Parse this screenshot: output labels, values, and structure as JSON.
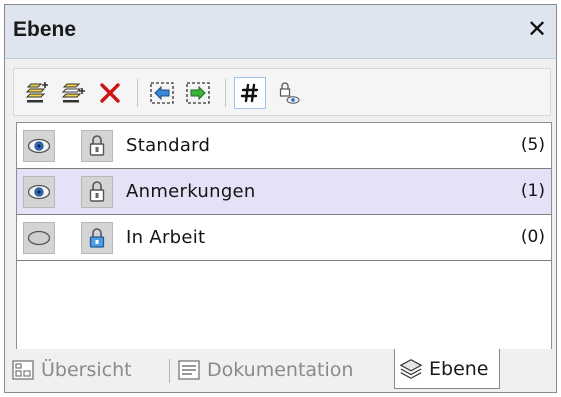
{
  "panel": {
    "title": "Ebene",
    "close_glyph": "✕"
  },
  "toolbar": {
    "buttons": [
      {
        "name": "add-layer-icon",
        "active": false
      },
      {
        "name": "insert-layer-icon",
        "active": false
      },
      {
        "name": "delete-layer-icon",
        "active": false
      },
      {
        "name": "move-to-layer-icon",
        "active": false
      },
      {
        "name": "move-from-layer-icon",
        "active": false
      },
      {
        "name": "show-grid-icon",
        "active": true
      },
      {
        "name": "lock-visibility-icon",
        "active": false
      }
    ]
  },
  "layers": [
    {
      "name": "Standard",
      "count": "(5)",
      "visible": true,
      "locked": false,
      "selected": false
    },
    {
      "name": "Anmerkungen",
      "count": "(1)",
      "visible": true,
      "locked": false,
      "selected": true
    },
    {
      "name": "In Arbeit",
      "count": "(0)",
      "visible": false,
      "locked": true,
      "selected": false
    }
  ],
  "tabs": [
    {
      "label": "Übersicht",
      "icon": "overview-icon",
      "active": false
    },
    {
      "label": "Dokumentation",
      "icon": "documentation-icon",
      "active": false
    },
    {
      "label": "Ebene",
      "icon": "layers-icon",
      "active": true
    }
  ],
  "colors": {
    "title_bar": "#dee5ee",
    "selected_row": "#e3e2f7",
    "active_button_border": "#9ec3ea",
    "delete_red": "#d01414",
    "arrow_blue": "#3a86d8",
    "arrow_green": "#3cb43c"
  }
}
